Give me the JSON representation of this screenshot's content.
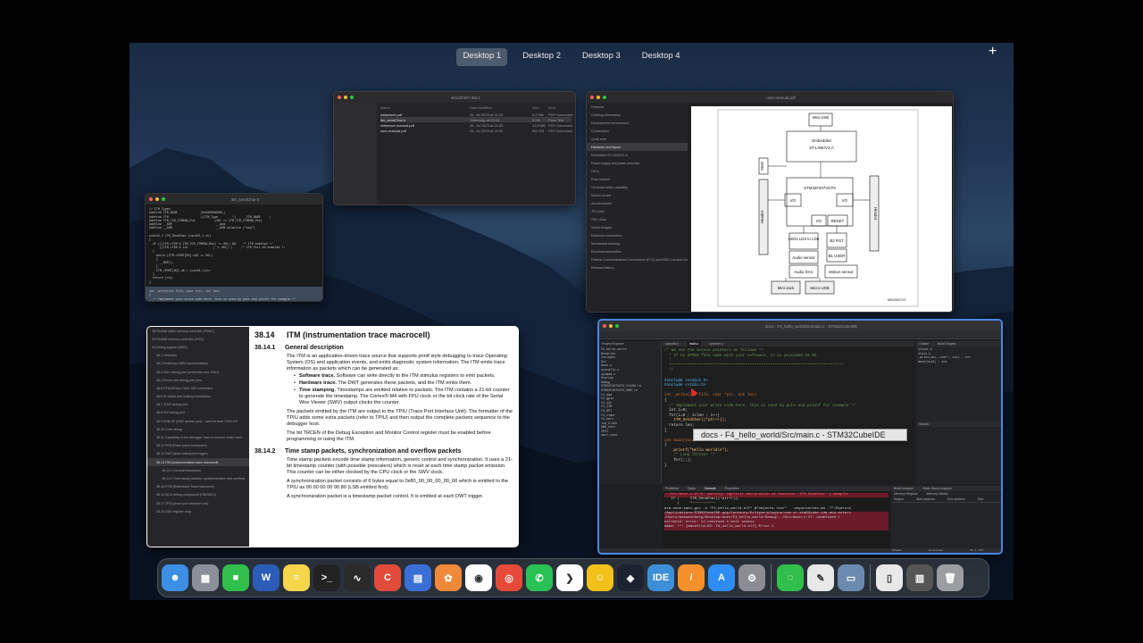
{
  "spaces": {
    "items": [
      "Desktop 1",
      "Desktop 2",
      "Desktop 3",
      "Desktop 4"
    ],
    "active": "Desktop 1",
    "add": "+"
  },
  "finder": {
    "title": "stm32f407-disc1",
    "columns": [
      "Name",
      "Date Modified",
      "Size",
      "Kind"
    ],
    "files": [
      [
        "datasheet.pdf",
        "26. Jul 2023 at 21:53",
        "6,2 MB",
        "PDF Document"
      ],
      [
        "itm_sendChar.h",
        "Yesterday at 23:54",
        "5 KB",
        "Plain Text"
      ],
      [
        "reference manual.pdf",
        "26. Jul 2023 at 21:53",
        "12,5 MB",
        "PDF Document"
      ],
      [
        "user-manual.pdf",
        "26. Jul 2023 at 21:52",
        "660 KB",
        "PDF Document"
      ]
    ]
  },
  "pdf_viewer": {
    "title": "user-manual.pdf",
    "toc": [
      "Features",
      "Ordering information",
      "Development environment",
      "Conventions",
      "Quick start",
      "Hardware and layout",
      "Embedded ST-LINK/V2-A",
      "Power supply and power selection",
      "LEDs",
      "Push buttons",
      "On-board audio capability",
      "Motion sensor",
      "Accelerometer",
      "JP1 (Idd)",
      "OSC clock",
      "Solder bridges",
      "Extension connectors",
      "Mechanical drawing",
      "Electrical schematics",
      "Federal Communications Commission (FCC) and ISED Canada Compliance Statements",
      "Revision history"
    ],
    "diagram": {
      "blocks": [
        "Mini USB",
        "Embedded",
        "ST-LINK/V2-A",
        "STM32F407VGT6",
        "I/O",
        "I/O",
        "I/O",
        "RESET",
        "LEDs LD3 to LD6",
        "B2 RST",
        "B1 USER",
        "Audio sensor",
        "Audio DAC",
        "Motion sensor",
        "Mini-Jack",
        "Micro-USB",
        "Header",
        "Header",
        "SWD"
      ],
      "id": "MSv31927V3"
    }
  },
  "terminal": {
    "title": "itm_sendChar.h",
    "lines": [
      "// ITM_Types",
      "#define ITM_BASE             (0xE0000000UL)",
      "#define ITM                  ((ITM_Type        *)      ITM_BASE     )",
      "#define ITM_TCR_ITMENA_Pos           (1UL << ITM_TCR_ITMENA_Pos)",
      "#define __NOP                         __asm",
      "#define __ASM                         __ASM volatile (\"nop\")",
      "",
      "uint32_t ITM_SendChar (uint32_t ch)",
      "{",
      "  if (((ITM->TCR & ITM_TCR_ITMENA_Msk) != 0UL) &&    /* ITM enabled */",
      "      ((ITM->TER & 1UL              ) != 0UL) )     /* ITM Port #0 enabled */",
      "  {",
      "    while (ITM->PORT[0U].u32 == 0UL)",
      "    {",
      "      __NOP();",
      "    }",
      "    ITM->PORT[0U].u8 = (uint8_t)ch;",
      "  }",
      "  return (ch);",
      "}"
    ],
    "selected": [
      "int _write(int file, char *ptr, int len)",
      "{",
      "  /* Implement your write code here, this is used by puts and printf for example */",
      "  int i=0;",
      "  for(i=0 ; i<len ; i++)",
      "    ITM_SendChar((*ptr++));",
      "  return len;",
      "}"
    ]
  },
  "reference_manual": {
    "toc": [
      "38 Flexible static memory controller (FSMC)",
      "39 Flexible memory controller (FMC)",
      "40 Debug support (DBG)",
      "38.1 Overview",
      "38.2 Reference ARM documentation",
      "38.3 SWJ debug port (serial wire and JTAG)",
      "38.4 Pinout and debug port pins",
      "38.5 STM32F4xx JTAG TAP connection",
      "38.6 ID codes and locking mechanism",
      "38.7 JTAG debug port",
      "38.8 SW debug port",
      "38.9 AHB-AP (AHB access port) - valid for both JTAG-DP",
      "38.10 Core debug",
      "38.11 Capability of the debugger host to connect under reset",
      "38.12 FPB (Flash patch breakpoint)",
      "38.13 DWT (data watchpoint trigger)",
      "38.14 ITM (instrumentation trace macrocell)",
      "38.14.1 General description",
      "38.14.2 Time stamp packets, synchronization and overflow",
      "38.15 ETM (Embedded Trace Macrocell)",
      "38.16 MCU debug component (DBGMCU)",
      "38.17 TPIU (trace port interface unit)",
      "38.18 DBG register map"
    ],
    "heading_num": "38.14",
    "heading": "ITM (instrumentation trace macrocell)",
    "s1_num": "38.14.1",
    "s1_title": "General description",
    "p1": "The ITM is an application-driven trace source that supports printf style debugging to trace Operating System (OS) and application events, and emits diagnostic system information. The ITM emits trace information as packets which can be generated as:",
    "b1_bold": "Software trace.",
    "b1_text": "Software can write directly to the ITM stimulus registers to emit packets.",
    "b2_bold": "Hardware trace.",
    "b2_text": "The DWT generates these packets, and the ITM emits them.",
    "b3_bold": "Time stamping.",
    "b3_text": "Timestamps are emitted relative to packets. The ITM contains a 21-bit counter to generate the timestamp. The Cortex®-M4 with FPU clock or the bit clock rate of the Serial Wire Viewer (SWV) output clocks the counter.",
    "p2": "The packets emitted by the ITM are output to the TPIU (Trace Port Interface Unit). The formatter of the TPIU adds some extra packets (refer to TPIU) and then output the complete packets sequence to the debugger host.",
    "p3": "The bit TRCEN of the Debug Exception and Monitor Control register must be enabled before programming or using the ITM.",
    "s2_num": "38.14.2",
    "s2_title": "Time stamp packets, synchronization and overflow packets",
    "p4": "Time stamp packets encode time stamp information, generic control and synchronization. It uses a 21-bit timestamp counter (with possible prescalers) which is reset at each time stamp packet emission. This counter can be either clocked by the CPU clock or the SWV clock.",
    "p5": "A synchronization packet consists of 6 bytes equal to 0x80_00_00_00_00_00 which is emitted to the TPIU as 00 00 00 00 00 80 (LSB emitted first).",
    "p6": "A synchronization packet is a timestamp packet control. It is emitted at each DWT trigger."
  },
  "ide": {
    "title": "docs - F4_hello_world/Src/main.c - STM32CubeIDE",
    "tooltip": "docs - F4_hello_world/Src/main.c - STM32CubeIDE",
    "tabs": [
      "Project Explorer",
      "syscalls.c",
      "main.c",
      "sysmem.c"
    ],
    "project_items": [
      "F4_hello_world",
      "Binaries",
      "Includes",
      "Src",
      "main.c",
      "syscalls.c",
      "sysmem.c",
      "Startup",
      "Debug",
      "STM32F407VGTX_FLASH.ld",
      "STM32F407VGTX_RAM.ld",
      "f4_dma",
      "f4_gpio",
      "f4_i2c",
      "f4_ITM",
      "f4_SPI",
      "f4_timer",
      "f4_uart",
      "led_blink",
      "SWO_test",
      "TEST",
      "uart_cube"
    ],
    "code": [
      "/* We use the access pointers as follows */",
      "  * If no STM32 file came with your software, it is provided AS-IS.",
      "  *",
      "  ****************************************************************************",
      "  */",
      "",
      "#include <stdint.h>",
      "#include <stdio.h>",
      "",
      "int _write(int file, char *ptr, int len)",
      "{",
      "  /* Implement your write code here, this is used by puts and printf for example */",
      "  int i=0;",
      "  for(i=0 ; i<len ; i++)",
      "    ITM_SendChar((*ptr++));",
      "  return len;",
      "}",
      "",
      "int main(void)",
      "{",
      "    printf(\"Hello World\\n\");",
      "    /* Loop forever */",
      "    for(;;);",
      "}"
    ],
    "outline_tabs": [
      "Outline",
      "Build Targets"
    ],
    "outline": [
      "stdint.h",
      "stdio.h",
      "_write(int, char*, int) : int",
      "main(void) : int"
    ],
    "search_tab": "Search",
    "bottom_tabs": [
      "Problems",
      "Tasks",
      "Console",
      "Properties"
    ],
    "console": [
      "../Src/main.c:27:5: warning: implicit declaration of function 'ITM_SendChar' [-Wimplic",
      "   27 |     ITM_SendChar((*ptr++));",
      "      |     ^~~~~~~~~~~~",
      "arm-none-eabi-gcc -o \"F4_hello_world.elf\" @\"objects.list\"   -mcpu=cortex-m4 -T\"/Users/a",
      "/Applications/STM32CubeIDE.app/Contents/Eclipse/plugins/com.st.stm32cube.ide.mcu.extern",
      "/Users/maxweinberg/Desktop/docs/F4_hello_world/Debug/../Src/main.c:27: undefined r",
      "collect2: error: ld returned 1 exit status",
      "make: *** [makefile:63: F4_hello_world.elf] Error 1"
    ],
    "build_tabs": [
      "Build Analyzer",
      "Static Stack Analyzer"
    ],
    "build_sub": [
      "Memory Regions",
      "Memory Details"
    ],
    "build_cols": [
      "Region",
      "Start address",
      "End address",
      "Size"
    ],
    "status": [
      "Writable",
      "Smart Insert",
      "26 : 1 : 673"
    ]
  },
  "dock": {
    "apps": [
      {
        "name": "finder",
        "color": "#3d8fe6",
        "glyph": "☻"
      },
      {
        "name": "launchpad",
        "color": "#8a8f99",
        "glyph": "▦"
      },
      {
        "name": "facetime",
        "color": "#2fbf4a",
        "glyph": "■"
      },
      {
        "name": "word",
        "color": "#2b5cb8",
        "glyph": "W"
      },
      {
        "name": "notes",
        "color": "#f5d54a",
        "glyph": "≡"
      },
      {
        "name": "terminal",
        "color": "#222",
        "glyph": ">_"
      },
      {
        "name": "activity-monitor",
        "color": "#2a2a2a",
        "glyph": "∿"
      },
      {
        "name": "ccleaner",
        "color": "#e24a3a",
        "glyph": "C"
      },
      {
        "name": "toolbox",
        "color": "#3b6fd8",
        "glyph": "▤"
      },
      {
        "name": "photos",
        "color": "#f08a3a",
        "glyph": "✿"
      },
      {
        "name": "davinci",
        "color": "#fff",
        "glyph": "◉"
      },
      {
        "name": "chrome",
        "color": "#e84a3a",
        "glyph": "◎"
      },
      {
        "name": "whatsapp",
        "color": "#29c154",
        "glyph": "✆"
      },
      {
        "name": "vscode",
        "color": "#fff",
        "glyph": "❯"
      },
      {
        "name": "cyberduck",
        "color": "#f2c21b",
        "glyph": "☺"
      },
      {
        "name": "cubemx",
        "color": "#1b2330",
        "glyph": "◆"
      },
      {
        "name": "ide",
        "color": "#3c8fd8",
        "glyph": "IDE"
      },
      {
        "name": "sublime",
        "color": "#f5902a",
        "glyph": "/"
      },
      {
        "name": "app-store",
        "color": "#2f8cf5",
        "glyph": "A"
      },
      {
        "name": "system-preferences",
        "color": "#8a8d93",
        "glyph": "⚙"
      },
      {
        "name": "messages",
        "color": "#2fbf4a",
        "glyph": "◌"
      },
      {
        "name": "textedit",
        "color": "#e8e8e8",
        "glyph": "✎"
      },
      {
        "name": "preview",
        "color": "#6b8ab0",
        "glyph": "▭"
      },
      {
        "name": "document",
        "color": "#e8e8e8",
        "glyph": "▯"
      },
      {
        "name": "downloads",
        "color": "#555",
        "glyph": "▥"
      },
      {
        "name": "trash",
        "color": "#9a9da2",
        "glyph": "🗑"
      }
    ]
  }
}
